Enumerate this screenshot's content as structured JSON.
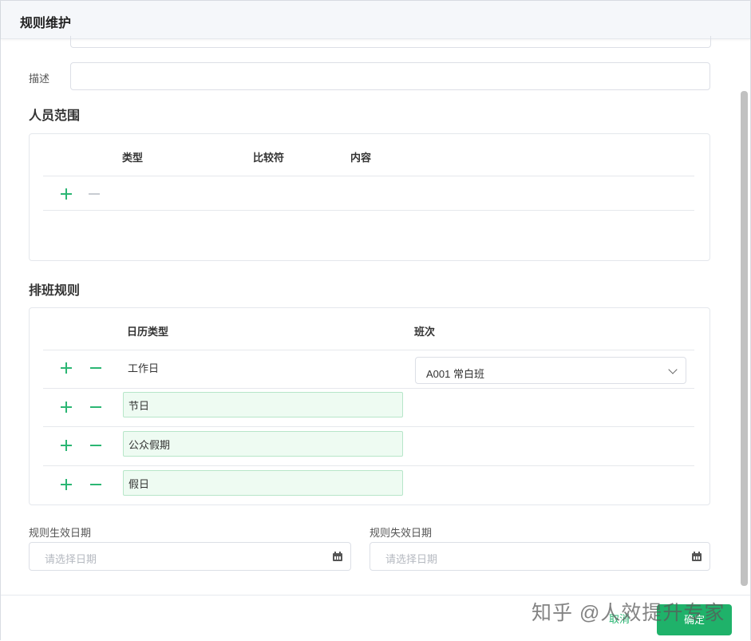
{
  "dialog": {
    "title": "规则维护"
  },
  "form": {
    "description_label": "描述",
    "description_value": ""
  },
  "personnel": {
    "title": "人员范围",
    "columns": [
      "类型",
      "比较符",
      "内容"
    ]
  },
  "schedule": {
    "title": "排班规则",
    "columns": [
      "日历类型",
      "班次"
    ],
    "rows": [
      {
        "calendar_type": "工作日",
        "shift": "A001 常白班"
      },
      {
        "calendar_type": "节日"
      },
      {
        "calendar_type": "公众假期"
      },
      {
        "calendar_type": "假日"
      }
    ]
  },
  "dates": {
    "effective_label": "规则生效日期",
    "effective_placeholder": "请选择日期",
    "expiry_label": "规则失效日期",
    "expiry_placeholder": "请选择日期"
  },
  "footer": {
    "cancel_label": "取消",
    "ok_label": "确定"
  },
  "watermark": "知乎 @人效提升专家",
  "colors": {
    "accent": "#2bb673",
    "primary_button": "#1fb26a",
    "highlight_fill": "#eefbf2"
  },
  "icons": [
    "plus-icon",
    "minus-icon",
    "chevron-down-icon",
    "calendar-icon"
  ]
}
